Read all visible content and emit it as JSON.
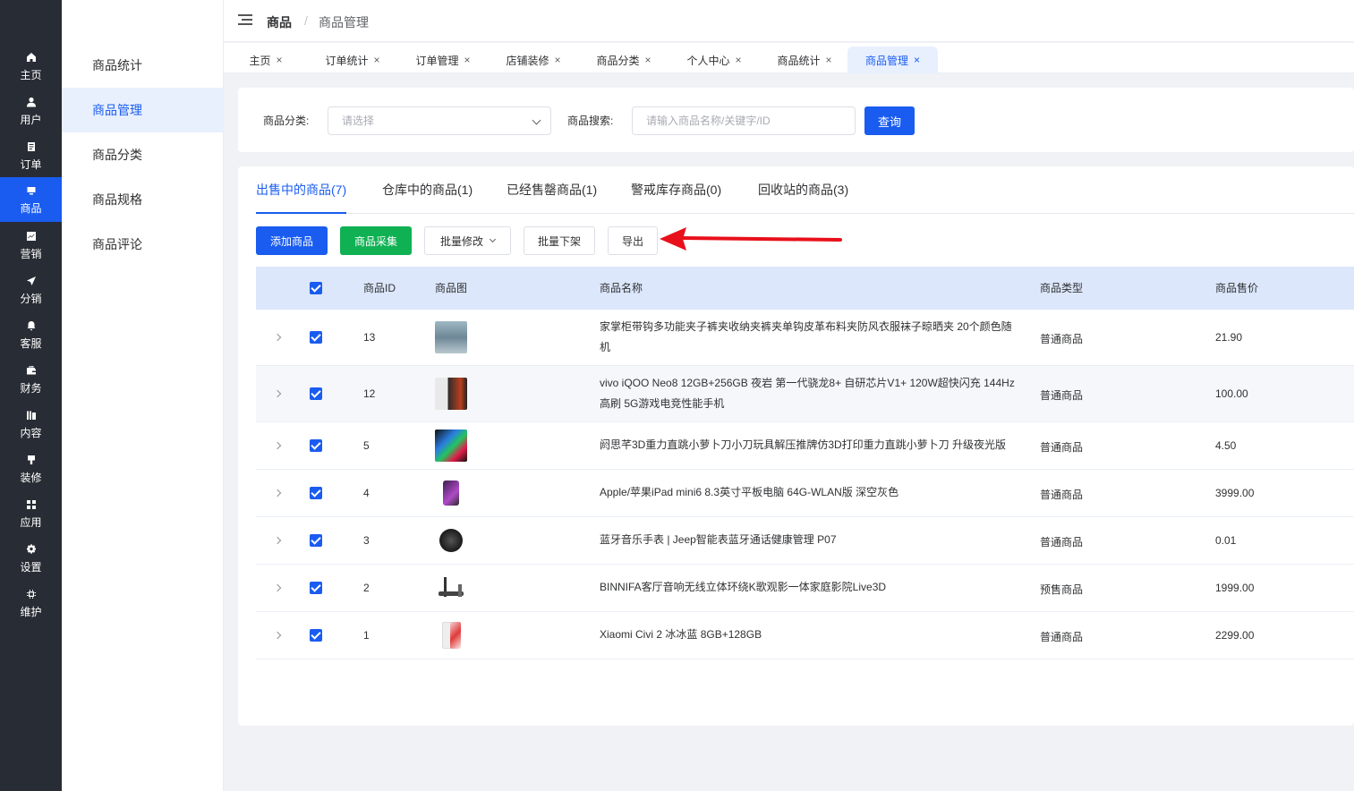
{
  "rail": [
    {
      "label": "主页",
      "icon": "home-icon"
    },
    {
      "label": "用户",
      "icon": "user-icon"
    },
    {
      "label": "订单",
      "icon": "order-icon"
    },
    {
      "label": "商品",
      "icon": "product-icon"
    },
    {
      "label": "营销",
      "icon": "marketing-icon"
    },
    {
      "label": "分销",
      "icon": "distribution-icon"
    },
    {
      "label": "客服",
      "icon": "service-icon"
    },
    {
      "label": "财务",
      "icon": "finance-icon"
    },
    {
      "label": "内容",
      "icon": "content-icon"
    },
    {
      "label": "装修",
      "icon": "decoration-icon"
    },
    {
      "label": "应用",
      "icon": "apps-icon"
    },
    {
      "label": "设置",
      "icon": "settings-icon"
    },
    {
      "label": "维护",
      "icon": "maintenance-icon"
    }
  ],
  "subnav": [
    "商品统计",
    "商品管理",
    "商品分类",
    "商品规格",
    "商品评论"
  ],
  "breadcrumb": {
    "root": "商品",
    "sep": "/",
    "current": "商品管理"
  },
  "tabs": [
    "主页",
    "订单统计",
    "订单管理",
    "店铺装修",
    "商品分类",
    "个人中心",
    "商品统计",
    "商品管理"
  ],
  "tab_close": "×",
  "search": {
    "category_label": "商品分类:",
    "category_placeholder": "请选择",
    "keyword_label": "商品搜索:",
    "keyword_placeholder": "请输入商品名称/关键字/ID",
    "query_button": "查询"
  },
  "product_tabs": [
    "出售中的商品(7)",
    "仓库中的商品(1)",
    "已经售罄商品(1)",
    "警戒库存商品(0)",
    "回收站的商品(3)"
  ],
  "actions": {
    "add": "添加商品",
    "collect": "商品采集",
    "batch_edit": "批量修改",
    "batch_off": "批量下架",
    "export": "导出"
  },
  "columns": {
    "id": "商品ID",
    "image": "商品图",
    "name": "商品名称",
    "type": "商品类型",
    "price": "商品售价"
  },
  "rows": [
    {
      "id": "13",
      "name": "家掌柜带钩多功能夹子裤夹收纳夹裤夹单钩皮革布料夹防风衣服袜子晾晒夹 20个颜色随机",
      "type": "普通商品",
      "price": "21.90"
    },
    {
      "id": "12",
      "name": "vivo iQOO Neo8 12GB+256GB 夜岩 第一代骁龙8+ 自研芯片V1+ 120W超快闪充 144Hz高刷 5G游戏电竞性能手机",
      "type": "普通商品",
      "price": "100.00"
    },
    {
      "id": "5",
      "name": "阏思芊3D重力直跳小萝卜刀小刀玩具解压推牌仿3D打印重力直跳小萝卜刀 升级夜光版",
      "type": "普通商品",
      "price": "4.50"
    },
    {
      "id": "4",
      "name": "Apple/苹果iPad mini6 8.3英寸平板电脑 64G-WLAN版 深空灰色",
      "type": "普通商品",
      "price": "3999.00"
    },
    {
      "id": "3",
      "name": "蓝牙音乐手表 | Jeep智能表蓝牙通话健康管理 P07",
      "type": "普通商品",
      "price": "0.01"
    },
    {
      "id": "2",
      "name": "BINNIFA客厅音响无线立体环绕K歌观影一体家庭影院Live3D",
      "type": "预售商品",
      "price": "1999.00"
    },
    {
      "id": "1",
      "name": "Xiaomi Civi 2 冰冰蓝 8GB+128GB",
      "type": "普通商品",
      "price": "2299.00"
    }
  ],
  "colors": {
    "primary": "#1a5cf0",
    "green": "#0fb153",
    "rail": "#282c34",
    "annotation_arrow": "#e8101a"
  }
}
